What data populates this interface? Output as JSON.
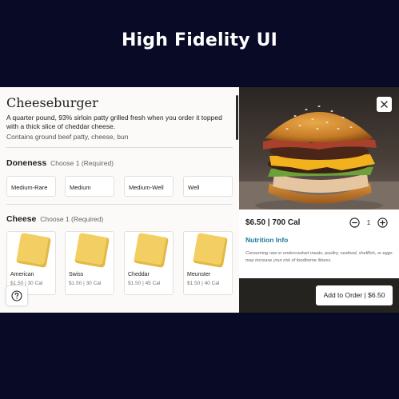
{
  "page": {
    "heading": "High Fidelity UI"
  },
  "item": {
    "title": "Cheeseburger",
    "description": "A quarter pound, 93% sirloin patty grilled fresh when you order it topped with a thick slice of cheddar cheese.",
    "contains": "Contains ground beef patty, cheese, bun"
  },
  "doneness": {
    "title": "Doneness",
    "subtitle": "Choose 1 (Required)",
    "options": [
      "Medium-Rare",
      "Medium",
      "Medium-Well",
      "Well"
    ]
  },
  "cheese": {
    "title": "Cheese",
    "subtitle": "Choose 1 (Required)",
    "options": [
      {
        "name": "American",
        "meta": "$1.50 | 30 Cal"
      },
      {
        "name": "Swiss",
        "meta": "$1.50 | 30 Cal"
      },
      {
        "name": "Cheddar",
        "meta": "$1.50 | 45 Cal"
      },
      {
        "name": "Meunster",
        "meta": "$1.50 | 40 Cal"
      }
    ]
  },
  "order": {
    "price_cal": "$6.50 | 700 Cal",
    "quantity": "1",
    "nutrition_link": "Nutrition Info",
    "warning": "Consuming raw or undercooked meats, poultry, seafood, shellfish, or eggs may increase your risk of foodborne illness.",
    "add_button": "Add to Order | $6.50"
  },
  "icons": {
    "help": "help-circle-icon",
    "close": "close-icon",
    "minus": "minus-circle-icon",
    "plus": "plus-circle-icon"
  },
  "colors": {
    "background": "#080a26",
    "panel": "#fbfaf8",
    "link": "#1f7a9c",
    "footer": "#25231f",
    "cheese": "#f3cf63"
  }
}
